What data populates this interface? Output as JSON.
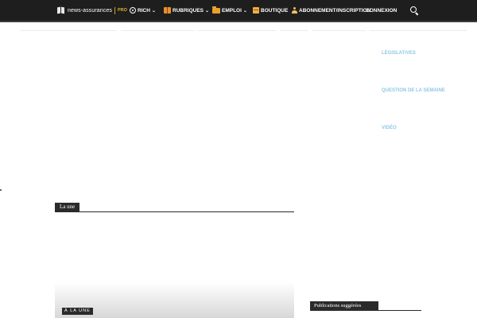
{
  "header": {
    "logo_text": "news-assurances",
    "logo_badge": "PRO",
    "nav": [
      {
        "label": "RICH",
        "icon": "target-icon",
        "has_dropdown": true
      },
      {
        "label": "RUBRIQUES",
        "icon": "book-icon",
        "has_dropdown": true
      },
      {
        "label": "EMPLOI",
        "icon": "folder-icon",
        "has_dropdown": true
      },
      {
        "label": "BOUTIQUE",
        "icon": "shop-icon",
        "has_dropdown": false
      },
      {
        "label": "ABONNEMENT/INSCRIPTION",
        "icon": "user-icon",
        "has_dropdown": false
      },
      {
        "label": "CONNEXION",
        "icon": "",
        "has_dropdown": false
      }
    ],
    "search_icon": "search-icon",
    "chevron_glyph": "⌄"
  },
  "sidebar_links": [
    "LÉGISLATIVES",
    "QUESTION DE LA SEMAINE",
    "VIDÉO"
  ],
  "main": {
    "section_title": "La une",
    "hero_badge": "À LA UNE"
  },
  "sidebar": {
    "suggested_title": "Publications suggérées"
  },
  "colors": {
    "topbar": "#1e1e1e",
    "link": "#8fc8e8",
    "label_bg": "#2b2b2b",
    "logo_accent": "#e0b030"
  }
}
